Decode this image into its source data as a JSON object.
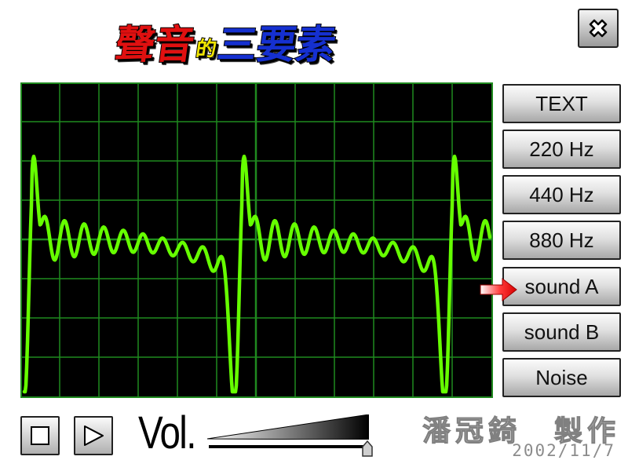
{
  "title": {
    "part1": "聲音",
    "part2": "的",
    "part3": "三要素"
  },
  "buttons": [
    {
      "label": "TEXT",
      "name": "text-button"
    },
    {
      "label": "220 Hz",
      "name": "220hz-button"
    },
    {
      "label": "440 Hz",
      "name": "440hz-button"
    },
    {
      "label": "880 Hz",
      "name": "880hz-button"
    },
    {
      "label": "sound A",
      "name": "sound-a-button"
    },
    {
      "label": "sound B",
      "name": "sound-b-button"
    },
    {
      "label": "Noise",
      "name": "noise-button"
    }
  ],
  "selected_button": "sound A",
  "volume": {
    "label": "Vol.",
    "level": 1.0
  },
  "author": "潘冠錡　製作",
  "date": "2002/11/7",
  "icons": {
    "close": "close-icon",
    "stop": "stop-icon",
    "play": "play-icon",
    "selection": "arrow-right-icon"
  },
  "colors": {
    "waveform": "#66ff00",
    "grid": "#1f8a1f",
    "scope_bg": "#000000",
    "title_red": "#e01010",
    "title_yellow": "#f2e600",
    "title_blue": "#1530d0"
  }
}
